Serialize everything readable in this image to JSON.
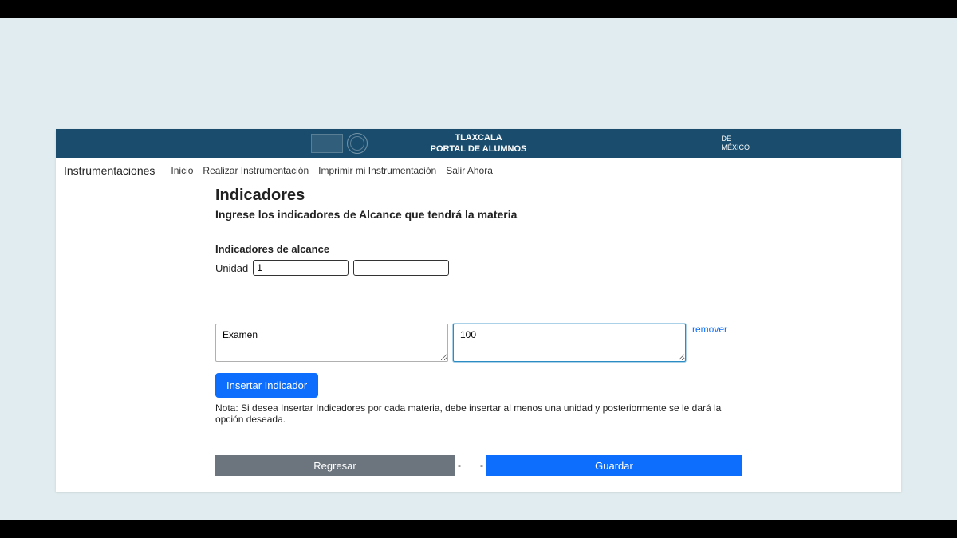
{
  "header": {
    "title_line1": "TLAXCALA",
    "title_line2": "PORTAL DE ALUMNOS",
    "right_line1": "DE",
    "right_line2": "MÉXICO"
  },
  "nav": {
    "section": "Instrumentaciones",
    "links": {
      "inicio": "Inicio",
      "realizar": "Realizar Instrumentación",
      "imprimir": "Imprimir mi Instrumentación",
      "salir": "Salir Ahora"
    }
  },
  "page": {
    "title": "Indicadores",
    "subtitle": "Ingrese los indicadores de Alcance que tendrá la materia",
    "section_label": "Indicadores de alcance",
    "unidad_label": "Unidad",
    "unidad_value": "1",
    "unidad_extra": "",
    "indicator_name": "Examen",
    "indicator_value": "100",
    "remove_link": "remover",
    "insert_button": "Insertar Indicador",
    "note": "Nota: Si desea Insertar Indicadores por cada materia, debe insertar al menos una unidad y posteriormente se le dará la opción deseada.",
    "back_button": "Regresar",
    "save_button": "Guardar"
  }
}
